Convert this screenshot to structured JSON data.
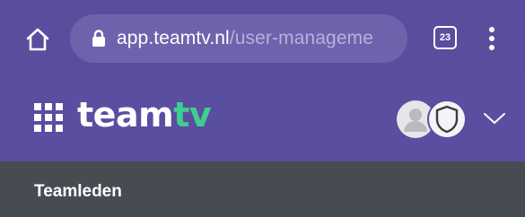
{
  "browser": {
    "url_domain": "app.teamtv.nl",
    "url_path": "/user-manageme",
    "tab_count": "23"
  },
  "app": {
    "logo_part1": "team",
    "logo_part2": "tv"
  },
  "section": {
    "title": "Teamleden"
  },
  "colors": {
    "browser_bar": "#5b4d9e",
    "url_pill": "#6f62ad",
    "header": "#5a4ea1",
    "logo_accent": "#3ecf8e",
    "section_bar": "#474c52"
  },
  "icons": [
    "home-icon",
    "lock-icon",
    "tab-switcher-icon",
    "more-vert-icon",
    "apps-grid-icon",
    "user-avatar-icon",
    "shield-icon",
    "chevron-down-icon"
  ]
}
